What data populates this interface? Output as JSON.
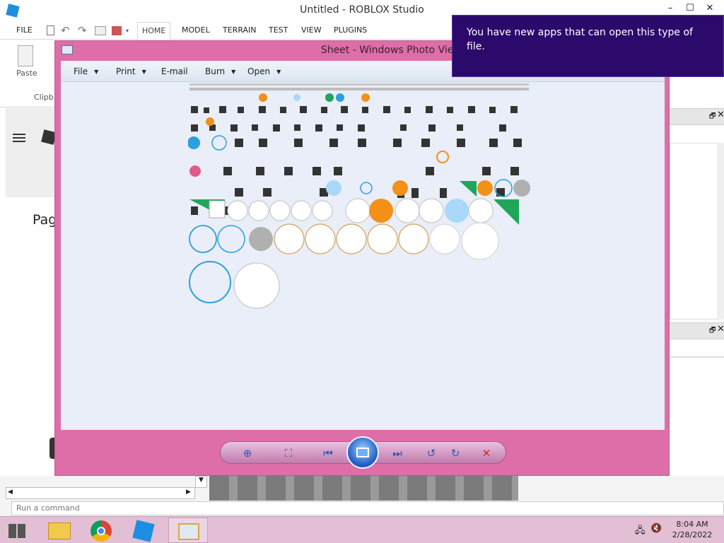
{
  "studio": {
    "title": "Untitled - ROBLOX Studio",
    "window_controls": [
      "–",
      "☐",
      "✕"
    ],
    "ribbon_tabs": [
      "FILE",
      "HOME",
      "MODEL",
      "TERRAIN",
      "TEST",
      "VIEW",
      "PLUGINS"
    ],
    "active_tab": "HOME",
    "paste_label": "Paste",
    "clipboard_group": "Clipb",
    "page_text": "Pag",
    "command_placeholder": "Run a command"
  },
  "notification": {
    "text": "You have new apps that can open this type of file."
  },
  "photo_viewer": {
    "title": "Sheet - Windows Photo Viewer",
    "menu": [
      "File",
      "Print",
      "E-mail",
      "Burn",
      "Open"
    ]
  },
  "taskbar": {
    "time": "8:04 AM",
    "date": "2/28/2022"
  },
  "colors": {
    "viewer_frame": "#dd6ea8",
    "toast_bg": "#2c0a6b",
    "taskbar_bg": "#e2bfd4",
    "sprite_orange": "#f39017",
    "sprite_blue": "#2d9fe0",
    "sprite_green": "#1fa65a"
  }
}
